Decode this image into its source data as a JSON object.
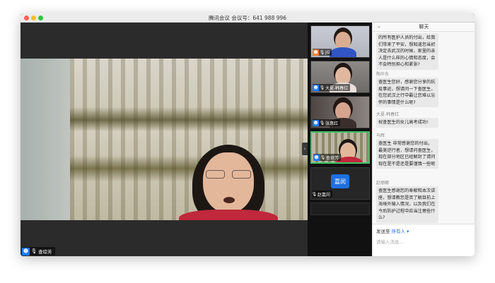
{
  "window": {
    "title": "腾讯会议 会议号：641 988 996"
  },
  "main_video": {
    "participant": "查琼芳"
  },
  "thumbnails": [
    {
      "name": "jG",
      "icon": "orange"
    },
    {
      "name": "大夏-韩春红",
      "icon": "blue"
    },
    {
      "name": "张惠红",
      "icon": "blue"
    },
    {
      "name": "查琼芳",
      "icon": "blue",
      "active": true
    },
    {
      "name": "赵嘉闵",
      "avatar_text": "嘉闵"
    }
  ],
  "chat": {
    "title": "聊天",
    "messages": [
      {
        "sender": "",
        "text": "的所有医护人员的付出，给我们带来了平安，想知道您当初决定去武汉的时候，家里的亲人是什么样的心情和态度，会不会特别担心和紧张?"
      },
      {
        "sender": "陶华东",
        "text": "查医生您好，感谢您分享的抗疫事迹，想请问一下查医生，在您武汉之行中最让您难以忘怀的事情是什么呢?"
      },
      {
        "sender": "大夏-韩春红",
        "text": "祝查医生的女儿高考成功!"
      },
      {
        "sender": "马辉",
        "text": "查医生 非常感谢您的付出，最美逆行者，想请问查医生，现在部分地区已经解封了请问现在是不是还是要谨慎一些呢"
      },
      {
        "sender": "赵丽娜",
        "text": "查医生感谢您的奉献和本次讲座，想请教您是否了解目前上海境外输入情况，以及我们在今后防护过程中应当注意些什么?"
      }
    ],
    "send_to_label": "发送至",
    "send_to_target": "所有人 ▾",
    "input_placeholder": "请输入消息..."
  }
}
